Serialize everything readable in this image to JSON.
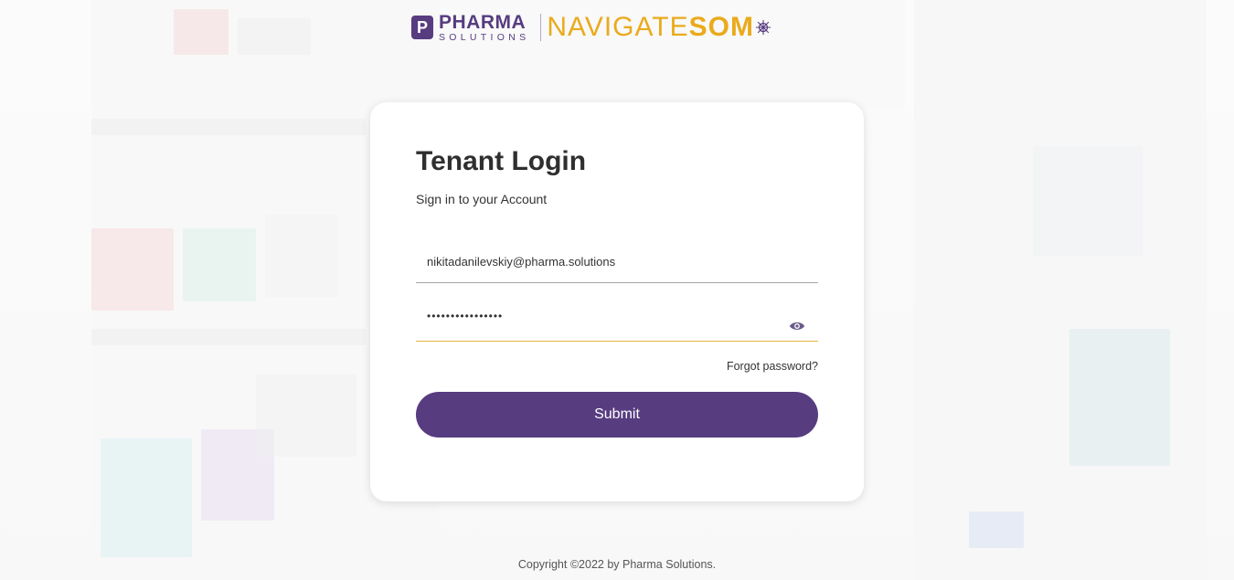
{
  "brand": {
    "pharma_big": "PHARMA",
    "pharma_small": "SOLUTIONS",
    "navigate_text": "NAVIGATE",
    "som_text": "SOM",
    "primary_color": "#573c80",
    "accent_color": "#eaaa1c"
  },
  "login": {
    "title": "Tenant Login",
    "subtitle": "Sign in to your Account",
    "email_value": "nikitadanilevskiy@pharma.solutions",
    "password_value": "••••••••••••••••",
    "password_toggle_icon": "eye-icon",
    "forgot_label": "Forgot password?",
    "submit_label": "Submit"
  },
  "footer": {
    "copyright": "Copyright ©2022 by Pharma Solutions."
  }
}
